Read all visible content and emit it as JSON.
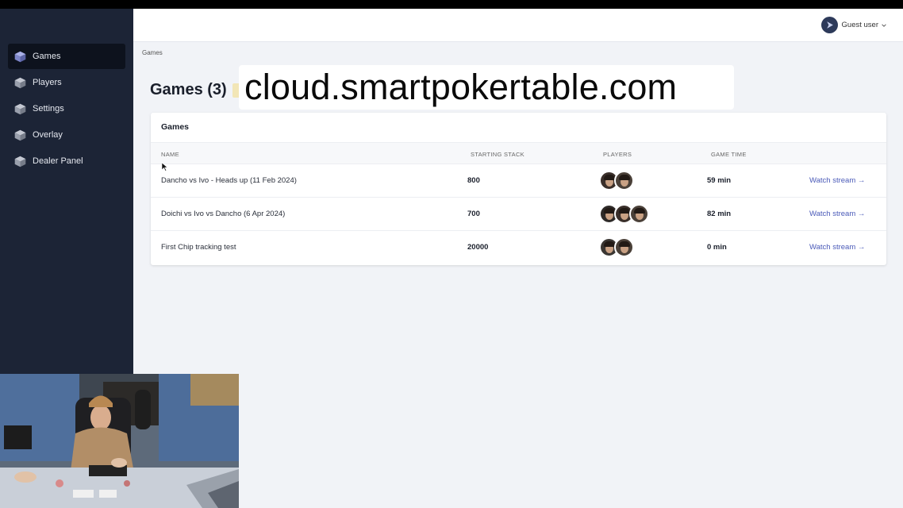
{
  "sidebar": {
    "items": [
      {
        "label": "Games",
        "active": true
      },
      {
        "label": "Players",
        "active": false
      },
      {
        "label": "Settings",
        "active": false
      },
      {
        "label": "Overlay",
        "active": false
      },
      {
        "label": "Dealer Panel",
        "active": false
      }
    ]
  },
  "header": {
    "user_label": "Guest user"
  },
  "breadcrumb": "Games",
  "page_title": "Games (3)",
  "url_overlay": "cloud.smartpokertable.com",
  "card": {
    "title": "Games",
    "columns": [
      "NAME",
      "STARTING STACK",
      "PLAYERS",
      "GAME TIME"
    ],
    "rows": [
      {
        "name": "Dancho vs Ivo - Heads up (11 Feb 2024)",
        "stack": "800",
        "players": 2,
        "time": "59 min",
        "action": "Watch stream →"
      },
      {
        "name": "Doichi vs Ivo vs Dancho (6 Apr 2024)",
        "stack": "700",
        "players": 3,
        "time": "82 min",
        "action": "Watch stream →"
      },
      {
        "name": "First Chip tracking test",
        "stack": "20000",
        "players": 2,
        "time": "0 min",
        "action": "Watch stream →"
      }
    ]
  },
  "colors": {
    "sidebar_bg": "#1c2436",
    "active_bg": "#0d121d",
    "link": "#4a5ab8",
    "page_bg": "#f1f3f7"
  }
}
